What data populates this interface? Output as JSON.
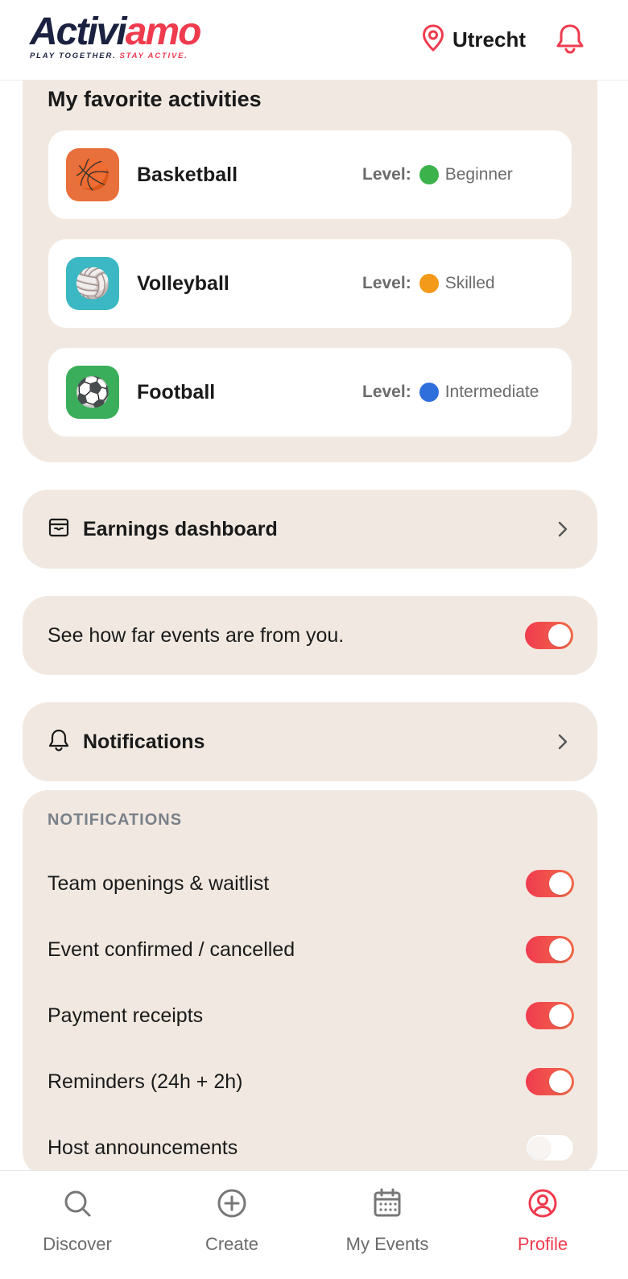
{
  "header": {
    "logo_part1": "Activi",
    "logo_part2": "amo",
    "tagline_part1": "PLAY TOGETHER.",
    "tagline_part2": "STAY ACTIVE.",
    "location": "Utrecht",
    "icons": {
      "location": "map-pin-icon",
      "notifications": "bell-icon"
    }
  },
  "favorites": {
    "title": "My favorite activities",
    "level_label": "Level:",
    "items": [
      {
        "name": "Basketball",
        "level": "Beginner",
        "level_color": "#3bb34a",
        "icon": "🏀",
        "icon_bg": "#e8703c"
      },
      {
        "name": "Volleyball",
        "level": "Skilled",
        "level_color": "#f39a1a",
        "icon": "🏐",
        "icon_bg": "#3cb8c4"
      },
      {
        "name": "Football",
        "level": "Intermediate",
        "level_color": "#2f6fdc",
        "icon": "⚽",
        "icon_bg": "#3aae5a"
      }
    ]
  },
  "earnings": {
    "label": "Earnings dashboard",
    "icon": "wallet-icon"
  },
  "distance": {
    "label": "See how far events are from you.",
    "enabled": true
  },
  "notifications_link": {
    "label": "Notifications",
    "icon": "bell-icon"
  },
  "notifications": {
    "section_label": "NOTIFICATIONS",
    "items": [
      {
        "label": "Team openings & waitlist",
        "enabled": true
      },
      {
        "label": "Event confirmed / cancelled",
        "enabled": true
      },
      {
        "label": "Payment receipts",
        "enabled": true
      },
      {
        "label": "Reminders (24h + 2h)",
        "enabled": true
      },
      {
        "label": "Host announcements",
        "enabled": false
      }
    ]
  },
  "nav": {
    "items": [
      {
        "label": "Discover",
        "icon": "search-icon",
        "active": false
      },
      {
        "label": "Create",
        "icon": "plus-circle-icon",
        "active": false
      },
      {
        "label": "My Events",
        "icon": "calendar-icon",
        "active": false
      },
      {
        "label": "Profile",
        "icon": "user-circle-icon",
        "active": true
      }
    ]
  },
  "colors": {
    "accent": "#ef3b4e",
    "card_bg": "#f1e9e1",
    "logo_dark": "#1b2140"
  }
}
